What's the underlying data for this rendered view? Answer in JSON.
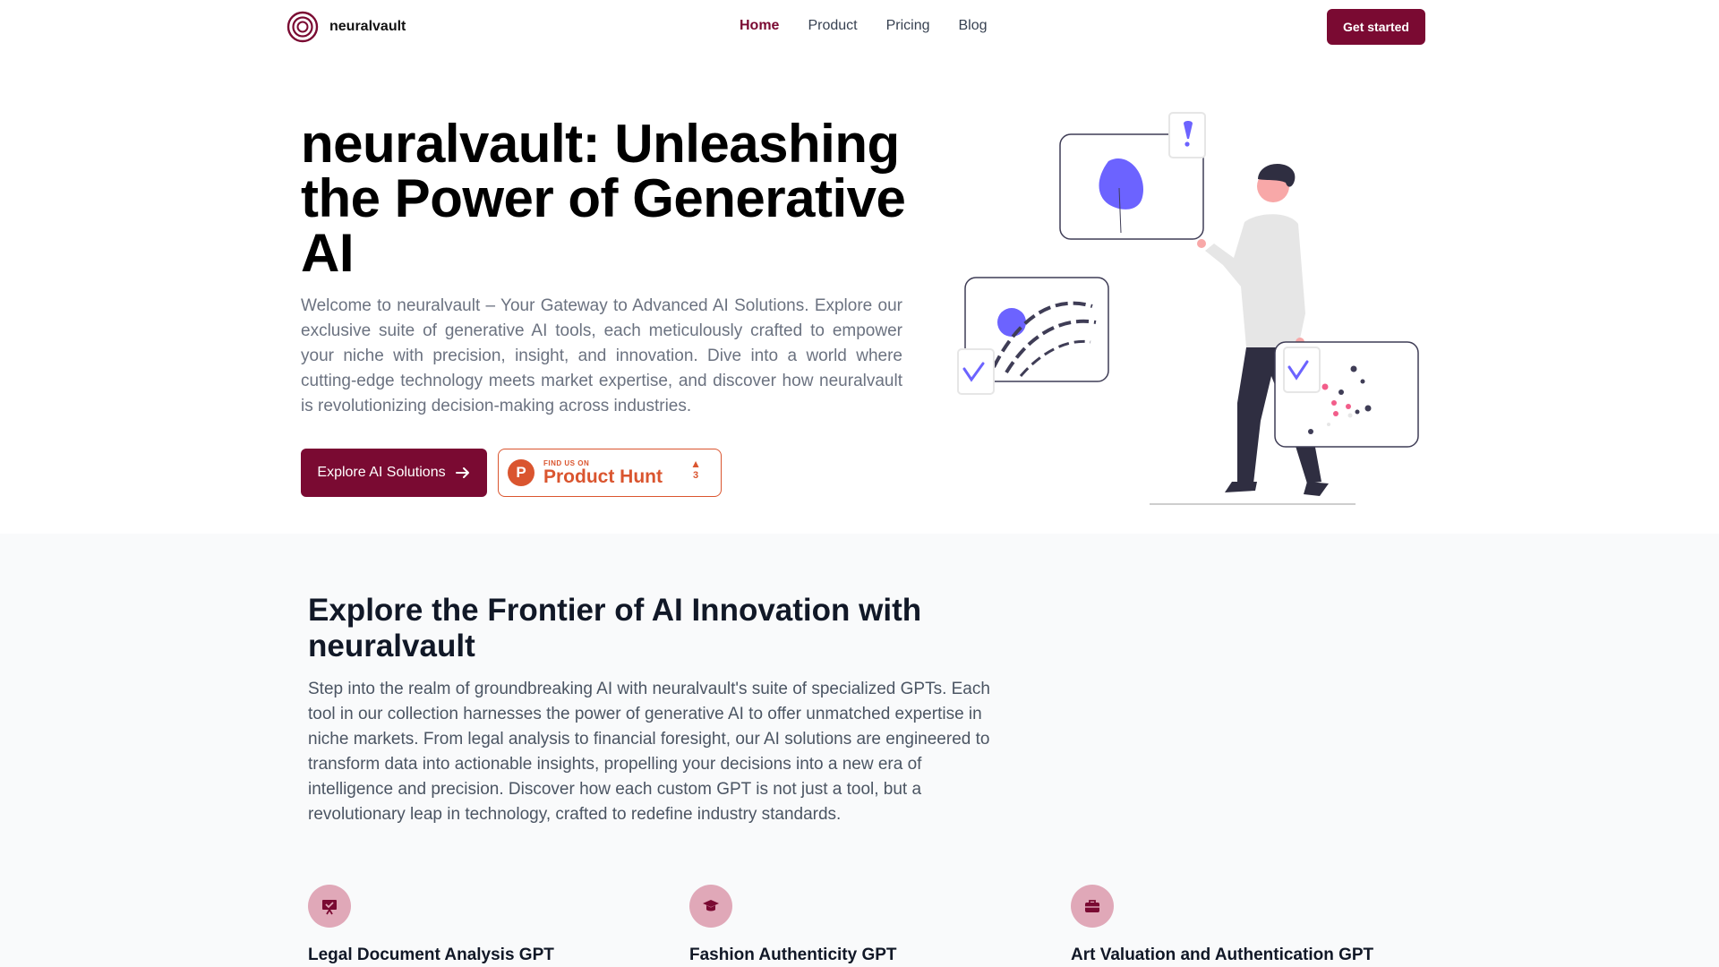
{
  "nav": {
    "brand": "neuralvault",
    "links": [
      "Home",
      "Product",
      "Pricing",
      "Blog"
    ],
    "active": "Home",
    "cta": "Get started"
  },
  "hero": {
    "title": "neuralvault: Unleashing the Power of Generative AI",
    "text": "Welcome to neuralvault – Your Gateway to Advanced AI Solutions. Explore our exclusive suite of generative AI tools, each meticulously crafted to empower your niche with precision, insight, and innovation. Dive into a world where cutting-edge technology meets market expertise, and discover how neuralvault is revolutionizing decision-making across industries.",
    "primary_button": "Explore AI Solutions",
    "product_hunt": {
      "small": "FIND US ON",
      "big": "Product Hunt",
      "votes": "3",
      "badge_letter": "P"
    }
  },
  "section2": {
    "title": "Explore the Frontier of AI Innovation with neuralvault",
    "text": "Step into the realm of groundbreaking AI with neuralvault's suite of specialized GPTs. Each tool in our collection harnesses the power of generative AI to offer unmatched expertise in niche markets. From legal analysis to financial foresight, our AI solutions are engineered to transform data into actionable insights, propelling your decisions into a new era of intelligence and precision. Discover how each custom GPT is not just a tool, but a revolutionary leap in technology, crafted to redefine industry standards."
  },
  "features": [
    {
      "title": "Legal Document Analysis GPT",
      "icon": "presentation-check-icon"
    },
    {
      "title": "Fashion Authenticity GPT",
      "icon": "graduation-cap-icon"
    },
    {
      "title": "Art Valuation and Authentication GPT",
      "icon": "briefcase-icon"
    }
  ],
  "colors": {
    "brand": "#7a0a32",
    "product_hunt": "#da552f",
    "accent_purple": "#6c63ff",
    "section_bg": "#f9fafb"
  }
}
